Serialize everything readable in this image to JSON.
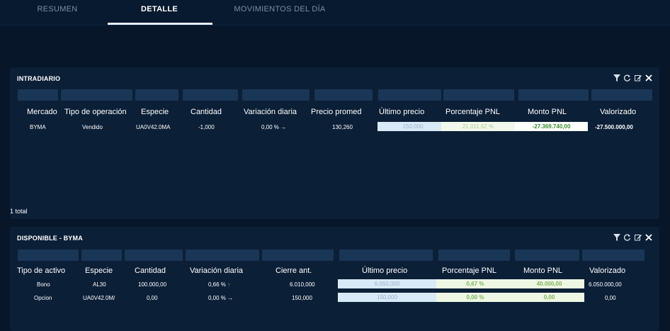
{
  "tabs": [
    {
      "label": "RESUMEN"
    },
    {
      "label": "DETALLE"
    },
    {
      "label": "MOVIMIENTOS DEL DÍA"
    }
  ],
  "intradiario": {
    "title": "INTRADIARIO",
    "columns": [
      "Mercado",
      "Tipo de operación",
      "Especie",
      "Cantidad",
      "Variación diaria",
      "Precio promed",
      "Último precio",
      "Porcentaje PNL",
      "Monto PNL",
      "Valorizado"
    ],
    "rows": [
      {
        "mercado": "BYMA",
        "tipo": "Vendido",
        "especie": "UA0V42.0MA",
        "cantidad": "-1,000",
        "variacion": "0,00 %",
        "variacion_arrow": "→",
        "precio_promed": "130,260",
        "ultimo_precio": "150,000",
        "porcentaje_pnl": "21.011,62 %",
        "monto_pnl": "-27.369.740,00",
        "valorizado": "-27.500.000,00"
      }
    ],
    "footer": "1 total"
  },
  "disponible": {
    "title": "DISPONIBLE - BYMA",
    "columns": [
      "Tipo de activo",
      "Especie",
      "Cantidad",
      "Variación diaria",
      "Cierre ant.",
      "Último precio",
      "Porcentaje PNL",
      "Monto PNL",
      "Valorizado"
    ],
    "rows": [
      {
        "tipo": "Bono",
        "especie": "AL30",
        "cantidad": "100.000,00",
        "variacion": "0,66 %",
        "variacion_arrow": "↑",
        "cierre": "6.010,000",
        "ultimo_precio": "6.050,000",
        "porcentaje_pnl": "0,67 %",
        "monto_pnl": "40.000,00",
        "valorizado": "6.050.000,00"
      },
      {
        "tipo": "Opcion",
        "especie": "UA0V42.0M/",
        "cantidad": "0,00",
        "variacion": "0,00 %",
        "variacion_arrow": "→",
        "cierre": "150,000",
        "ultimo_precio": "150,000",
        "porcentaje_pnl": "0,00 %",
        "monto_pnl": "0,00",
        "valorizado": "0,00"
      }
    ]
  },
  "tools": {
    "filter_icon": "filter-icon",
    "refresh_icon": "refresh-icon",
    "edit_icon": "edit-icon",
    "close_icon": "close-icon"
  },
  "colors": {
    "background": "#071628",
    "panel": "#0b1f37",
    "filter_box": "#1a3656",
    "positive": "#3cc25a"
  }
}
